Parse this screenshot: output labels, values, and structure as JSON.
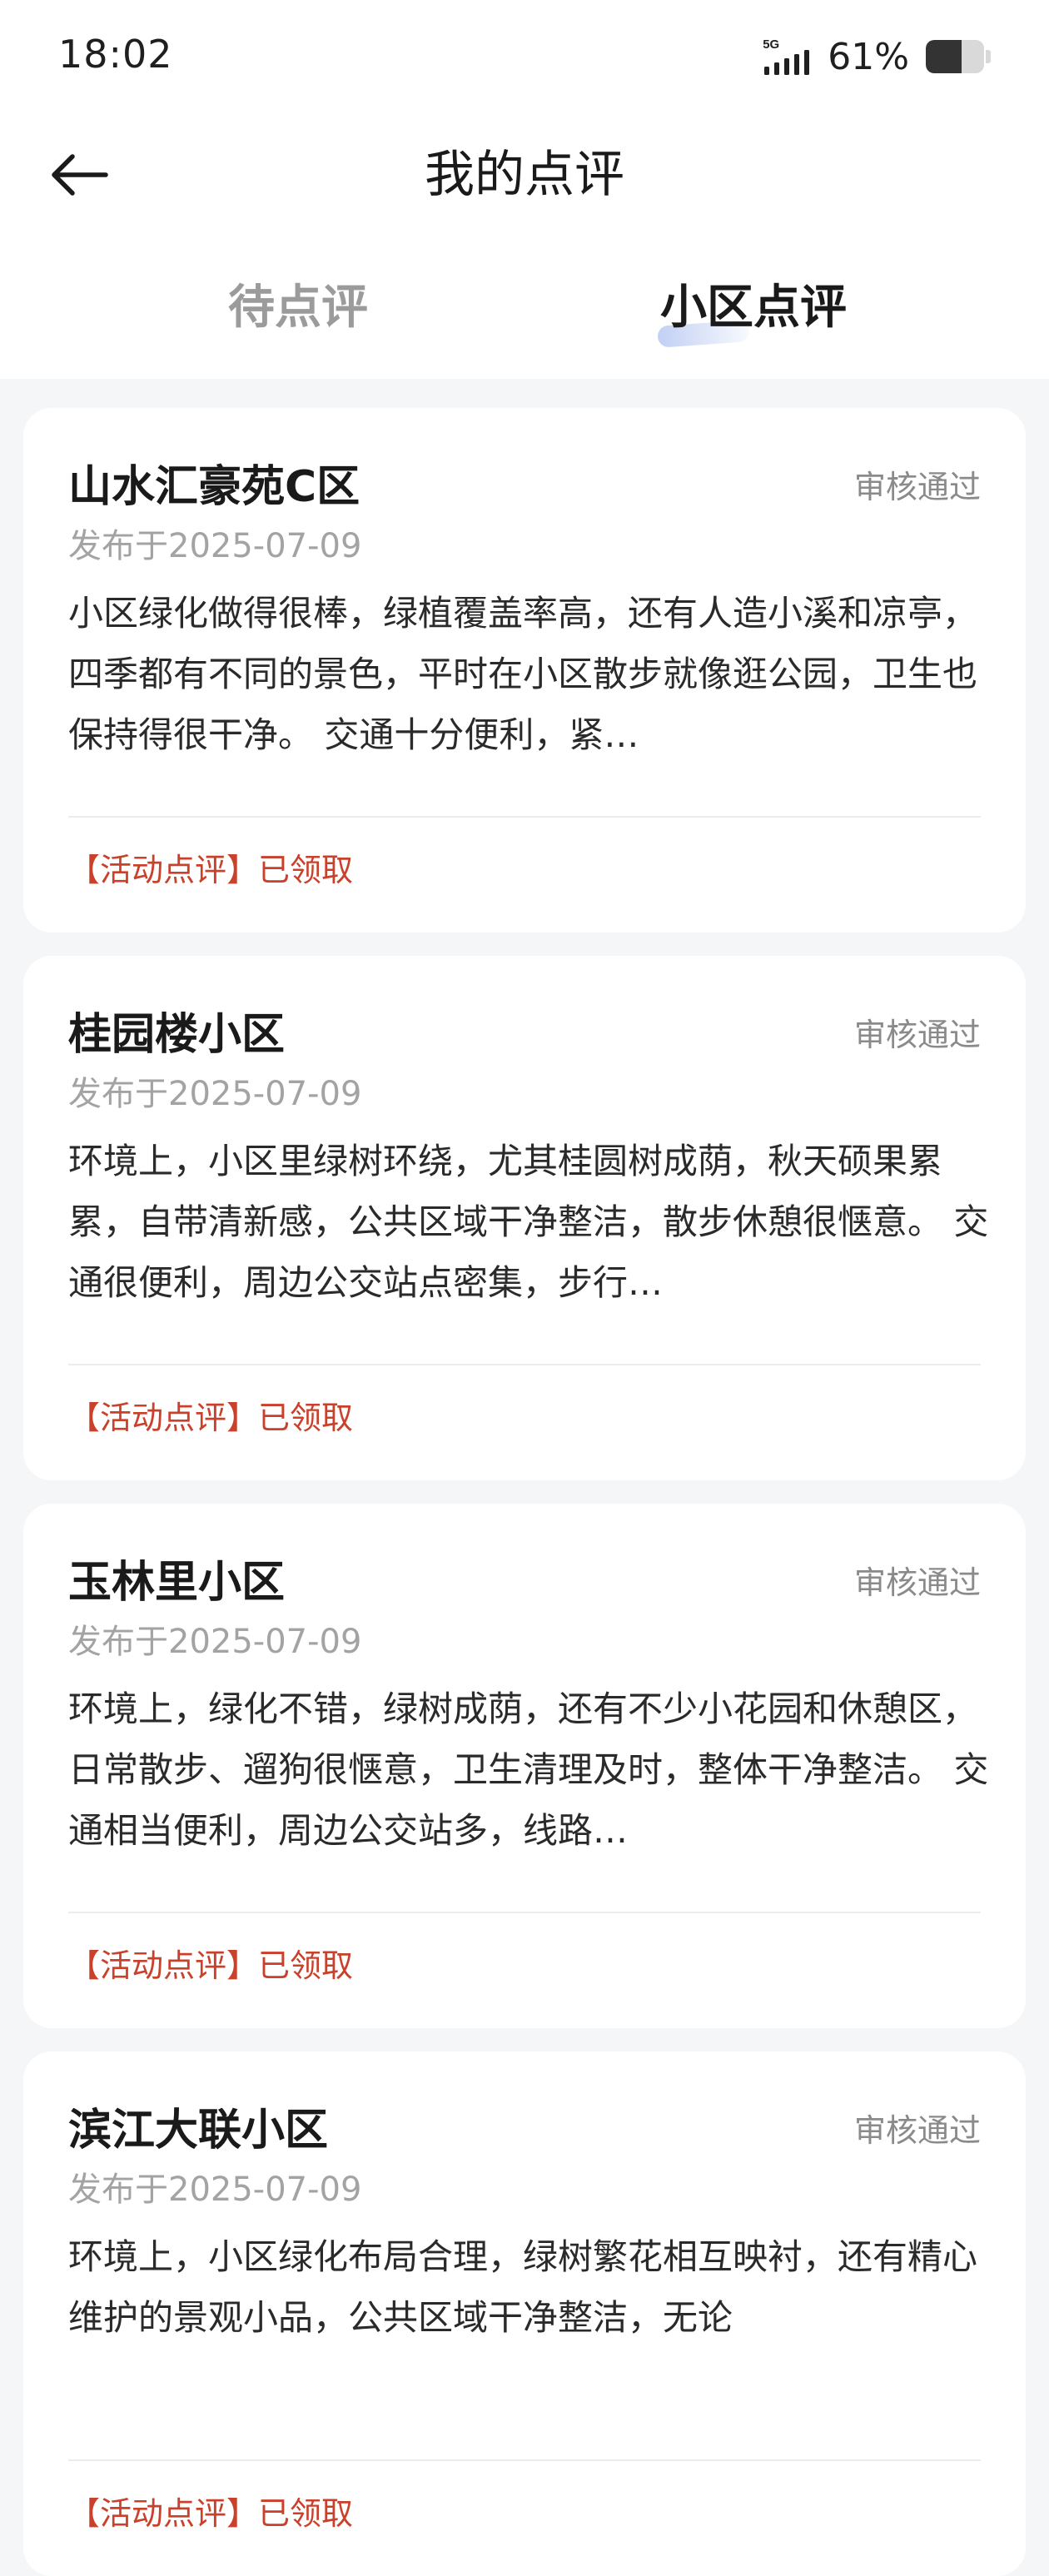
{
  "status_bar": {
    "time": "18:02",
    "network": "5G",
    "battery_percent": "61%",
    "battery_level": 0.61
  },
  "nav": {
    "back_icon": "arrow-left-icon",
    "title": "我的点评"
  },
  "tabs": [
    {
      "label": "待点评",
      "active": false
    },
    {
      "label": "小区点评",
      "active": true
    }
  ],
  "colors": {
    "reward": "#c9402b",
    "status": "#8a8a8a",
    "tab_inactive": "#9b9b9b",
    "background": "#f5f6f8"
  },
  "reviews": [
    {
      "name": "山水汇豪苑C区",
      "status": "审核通过",
      "date": "发布于2025-07-09",
      "content": "小区绿化做得很棒，绿植覆盖率高，还有人造小溪和凉亭，四季都有不同的景色，平时在小区散步就像逛公园，卫生也保持得很干净。 交通十分便利，紧…",
      "reward": "【活动点评】已领取"
    },
    {
      "name": "桂园楼小区",
      "status": "审核通过",
      "date": "发布于2025-07-09",
      "content": "环境上，小区里绿树环绕，尤其桂圆树成荫，秋天硕果累累，自带清新感，公共区域干净整洁，散步休憩很惬意。 交通很便利，周边公交站点密集，步行…",
      "reward": "【活动点评】已领取"
    },
    {
      "name": "玉林里小区",
      "status": "审核通过",
      "date": "发布于2025-07-09",
      "content": "环境上，绿化不错，绿树成荫，还有不少小花园和休憩区，日常散步、遛狗很惬意，卫生清理及时，整体干净整洁。 交通相当便利，周边公交站多，线路…",
      "reward": "【活动点评】已领取"
    },
    {
      "name": "滨江大联小区",
      "status": "审核通过",
      "date": "发布于2025-07-09",
      "content": " 环境上，小区绿化布局合理，绿树繁花相互映衬，还有精心维护的景观小品，公共区域干净整洁，无论",
      "reward": "【活动点评】已领取"
    }
  ]
}
